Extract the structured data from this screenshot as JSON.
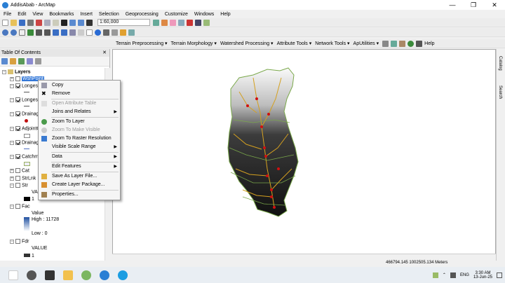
{
  "window": {
    "title": "AddisAbab - ArcMap",
    "minimize": "—",
    "maximize": "❐",
    "close": "✕"
  },
  "menu": [
    "File",
    "Edit",
    "View",
    "Bookmarks",
    "Insert",
    "Selection",
    "Geoprocessing",
    "Customize",
    "Windows",
    "Help"
  ],
  "toolbar": {
    "scale": "1:60,000"
  },
  "toolbar2": {
    "items": [
      "Terrain Preprocessing ▾",
      "Terrain Morphology ▾",
      "Watershed Processing ▾",
      "Attribute Tools ▾",
      "Network Tools ▾",
      "ApUtilities ▾"
    ],
    "help": "Help"
  },
  "toc": {
    "title": "Table Of Contents",
    "pin": "⊞",
    "close": "✕",
    "root": "Layers"
  },
  "layers": [
    {
      "name": "WshPoint",
      "checked": false,
      "sel": true
    },
    {
      "name": "LongestFlowPath",
      "checked": true
    },
    {
      "name": "LongestFlowPath",
      "checked": true
    },
    {
      "name": "DrainagePoint",
      "checked": true
    },
    {
      "name": "AdjointCatchment",
      "checked": true
    },
    {
      "name": "DrainageLine",
      "checked": true
    },
    {
      "name": "Catchment",
      "checked": true
    },
    {
      "name": "Cat",
      "checked": false
    },
    {
      "name": "StrLnk",
      "checked": false
    },
    {
      "name": "Str",
      "checked": false
    },
    {
      "name": "Fac",
      "checked": false
    },
    {
      "name": "Fdr",
      "checked": false
    }
  ],
  "legend": {
    "str_value": "VALUE",
    "str_one": "1",
    "fac_value": "Value",
    "fac_high": "High : 11728",
    "fac_low": "Low : 0",
    "fdr_value": "VALUE",
    "fdr_one": "1"
  },
  "context_menu": [
    {
      "label": "Copy",
      "icon": "copy-icon",
      "disabled": false
    },
    {
      "label": "Remove",
      "icon": "remove-icon",
      "disabled": false
    },
    {
      "label": "Open Attribute Table",
      "icon": "table-icon",
      "disabled": true
    },
    {
      "label": "Joins and Relates",
      "icon": "",
      "disabled": false,
      "sub": true
    },
    {
      "label": "Zoom To Layer",
      "icon": "zoom-layer-icon",
      "disabled": false
    },
    {
      "label": "Zoom To Make Visible",
      "icon": "zoom-visible-icon",
      "disabled": true
    },
    {
      "label": "Zoom To Raster Resolution",
      "icon": "raster-icon",
      "disabled": false
    },
    {
      "label": "Visible Scale Range",
      "icon": "",
      "disabled": false,
      "sub": true
    },
    {
      "label": "Data",
      "icon": "",
      "disabled": false,
      "sub": true
    },
    {
      "label": "Edit Features",
      "icon": "",
      "disabled": false,
      "sub": true
    },
    {
      "label": "Save As Layer File...",
      "icon": "save-layer-icon",
      "disabled": false
    },
    {
      "label": "Create Layer Package...",
      "icon": "package-icon",
      "disabled": false
    },
    {
      "label": "Properties...",
      "icon": "properties-icon",
      "disabled": false
    }
  ],
  "right_dock": {
    "catalog": "Catalog",
    "search": "Search"
  },
  "status": {
    "coords": "466794.145  1002505.134 Meters"
  },
  "tray": {
    "lang": "ENG",
    "time": "3:30 AM",
    "date": "13-Jun-25"
  },
  "colors": {
    "stream": "#d4a020",
    "outlet": "#d01010",
    "catchment_edge": "#7aa84a"
  }
}
